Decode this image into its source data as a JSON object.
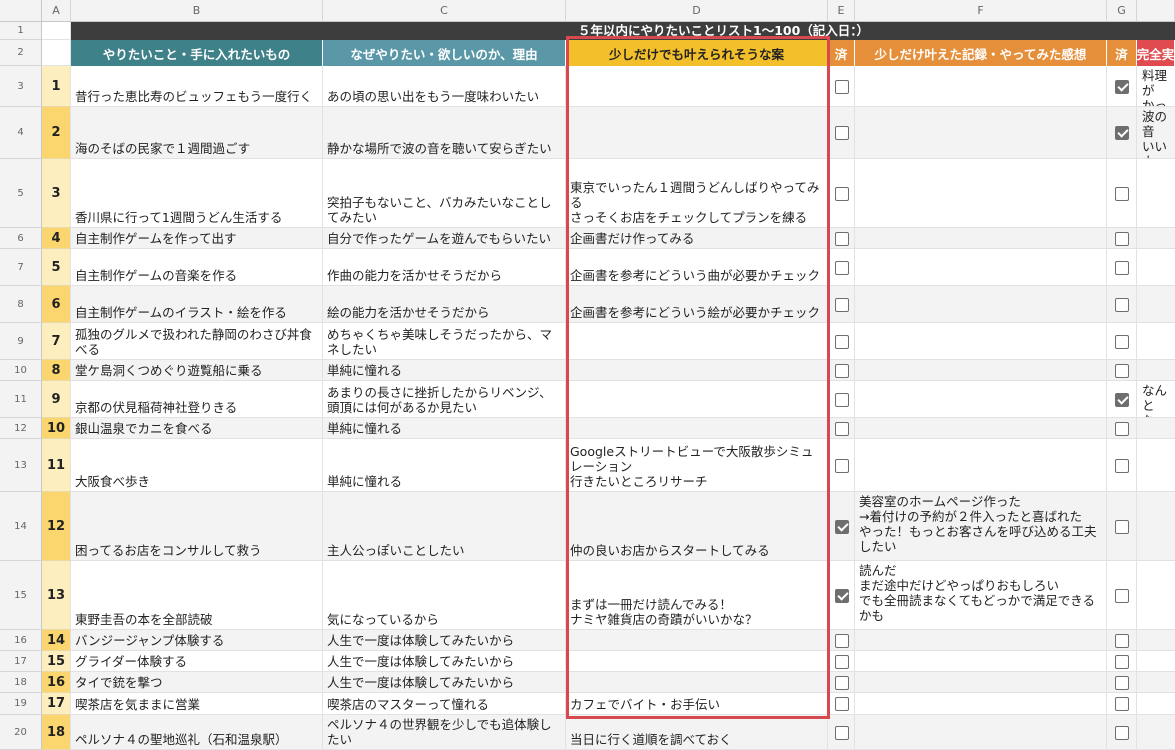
{
  "columns": [
    "A",
    "B",
    "C",
    "D",
    "E",
    "F",
    "G"
  ],
  "sheet_title": "５年以内にやりたいことリスト1〜100（記入日：）",
  "headers": {
    "B": "やりたいこと・手に入れたいもの",
    "C": "なぜやりたい・欲しいのか、理由",
    "D": "少しだけでも叶えられそうな案",
    "E": "済",
    "F": "少しだけ叶えた記録・やってみた感想",
    "G": "済",
    "H": "完全実"
  },
  "header_colors": {
    "B": "#3f8189",
    "C": "#5a98a8",
    "D": "#f3c02b",
    "E": "#e58f3a",
    "F": "#e58f3a",
    "G": "#e58f3a",
    "H": "#df4b4f"
  },
  "highlight_color": "#d64a4f",
  "row_numbers": [
    "1",
    "2",
    "3",
    "4",
    "5",
    "6",
    "7",
    "8",
    "9",
    "10",
    "11",
    "12",
    "13",
    "14",
    "15",
    "16",
    "17",
    "18",
    "19",
    "20"
  ],
  "rows": [
    {
      "n": "1",
      "b": "昔行った恵比寿のビュッフェもう一度行く",
      "c": "あの頃の思い出をもう一度味わいたい",
      "d": "",
      "e": false,
      "f": "",
      "g": true,
      "h": "料理が\nかった"
    },
    {
      "n": "2",
      "b": "海のそばの民家で１週間過ごす",
      "c": "静かな場所で波の音を聴いて安らぎたい",
      "d": "",
      "e": false,
      "f": "",
      "g": true,
      "h": "波の音\nいい人\nらった"
    },
    {
      "n": "3",
      "b": "香川県に行って1週間うどん生活する",
      "c": "突拍子もないこと、バカみたいなことしてみたい",
      "d": "東京でいったん１週間うどんしばりやってみる\nさっそくお店をチェックしてプランを練る",
      "e": false,
      "f": "",
      "g": false,
      "h": ""
    },
    {
      "n": "4",
      "b": "自主制作ゲームを作って出す",
      "c": "自分で作ったゲームを遊んでもらいたい",
      "d": "企画書だけ作ってみる",
      "e": false,
      "f": "",
      "g": false,
      "h": ""
    },
    {
      "n": "5",
      "b": "自主制作ゲームの音楽を作る",
      "c": "作曲の能力を活かせそうだから",
      "d": "企画書を参考にどういう曲が必要かチェック",
      "e": false,
      "f": "",
      "g": false,
      "h": ""
    },
    {
      "n": "6",
      "b": "自主制作ゲームのイラスト・絵を作る",
      "c": "絵の能力を活かせそうだから",
      "d": "企画書を参考にどういう絵が必要かチェック",
      "e": false,
      "f": "",
      "g": false,
      "h": ""
    },
    {
      "n": "7",
      "b": "孤独のグルメで扱われた静岡のわさび丼食べる",
      "c": "めちゃくちゃ美味しそうだったから、マネしたい",
      "d": "",
      "e": false,
      "f": "",
      "g": false,
      "h": ""
    },
    {
      "n": "8",
      "b": "堂ケ島洞くつめぐり遊覧船に乗る",
      "c": "単純に憧れる",
      "d": "",
      "e": false,
      "f": "",
      "g": false,
      "h": ""
    },
    {
      "n": "9",
      "b": "京都の伏見稲荷神社登りきる",
      "c": "あまりの長さに挫折したからリベンジ、頭頂には何があるか見たい",
      "d": "",
      "e": false,
      "f": "",
      "g": true,
      "h": "なんと\nなった"
    },
    {
      "n": "10",
      "b": "銀山温泉でカニを食べる",
      "c": "単純に憧れる",
      "d": "",
      "e": false,
      "f": "",
      "g": false,
      "h": ""
    },
    {
      "n": "11",
      "b": "大阪食べ歩き",
      "c": "単純に憧れる",
      "d": "Googleストリートビューで大阪散歩シミュレーション\n行きたいところリサーチ",
      "e": false,
      "f": "",
      "g": false,
      "h": ""
    },
    {
      "n": "12",
      "b": "困ってるお店をコンサルして救う",
      "c": "主人公っぽいことしたい",
      "d": "仲の良いお店からスタートしてみる",
      "e": true,
      "f": "美容室のホームページ作った\n→着付けの予約が２件入ったと喜ばれた\nやった！もっとお客さんを呼び込める工夫したい",
      "g": false,
      "h": ""
    },
    {
      "n": "13",
      "b": "東野圭吾の本を全部読破",
      "c": "気になっているから",
      "d": "まずは一冊だけ読んでみる！\nナミヤ雑貨店の奇蹟がいいかな？",
      "e": true,
      "f": "読んだ\nまだ途中だけどやっぱりおもしろい\nでも全冊読まなくてもどっかで満足できるかも",
      "g": false,
      "h": ""
    },
    {
      "n": "14",
      "b": "バンジージャンプ体験する",
      "c": "人生で一度は体験してみたいから",
      "d": "",
      "e": false,
      "f": "",
      "g": false,
      "h": ""
    },
    {
      "n": "15",
      "b": "グライダー体験する",
      "c": "人生で一度は体験してみたいから",
      "d": "",
      "e": false,
      "f": "",
      "g": false,
      "h": ""
    },
    {
      "n": "16",
      "b": "タイで銃を撃つ",
      "c": "人生で一度は体験してみたいから",
      "d": "",
      "e": false,
      "f": "",
      "g": false,
      "h": ""
    },
    {
      "n": "17",
      "b": "喫茶店を気ままに営業",
      "c": "喫茶店のマスターって憧れる",
      "d": "カフェでバイト・お手伝い",
      "e": false,
      "f": "",
      "g": false,
      "h": ""
    },
    {
      "n": "18",
      "b": "ペルソナ４の聖地巡礼（石和温泉駅）",
      "c": "ペルソナ４の世界観を少しでも追体験したい",
      "d": "当日に行く道順を調べておく",
      "e": false,
      "f": "",
      "g": false,
      "h": ""
    }
  ]
}
